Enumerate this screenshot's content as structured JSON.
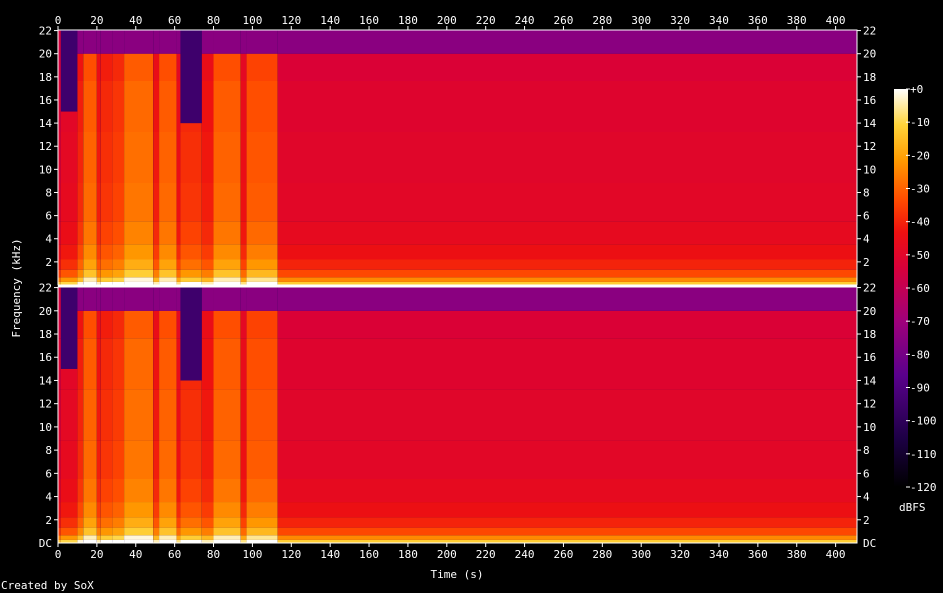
{
  "chart_data": {
    "type": "heatmap",
    "title": "",
    "xlabel": "Time (s)",
    "ylabel": "Frequency (kHz)",
    "xlim": [
      0,
      411
    ],
    "ylim": [
      0,
      22.05
    ],
    "x_ticks": [
      "0",
      "20",
      "40",
      "60",
      "80",
      "100",
      "120",
      "140",
      "160",
      "180",
      "200",
      "220",
      "240",
      "260",
      "280",
      "300",
      "320",
      "340",
      "360",
      "380",
      "400"
    ],
    "y_ticks": [
      "2",
      "4",
      "6",
      "8",
      "10",
      "12",
      "14",
      "16",
      "18",
      "20",
      "22"
    ],
    "y_bottom_label": "DC",
    "channels": 2,
    "colorbar": {
      "label": "dBFS",
      "range": [
        -120,
        0
      ],
      "ticks": [
        "+0",
        "-10",
        "-20",
        "-30",
        "-40",
        "-50",
        "-60",
        "-70",
        "-80",
        "-90",
        "-100",
        "-110",
        "-120"
      ]
    },
    "segments": [
      {
        "start": 0,
        "end": 1.5,
        "level": -52,
        "cutoff_khz": 22
      },
      {
        "start": 1.5,
        "end": 10,
        "level": -48,
        "cutoff_khz": 15
      },
      {
        "start": 10,
        "end": 13,
        "level": -40,
        "cutoff_khz": 20
      },
      {
        "start": 13,
        "end": 20,
        "level": -30,
        "cutoff_khz": 20
      },
      {
        "start": 20,
        "end": 22,
        "level": -42,
        "cutoff_khz": 20
      },
      {
        "start": 22,
        "end": 28,
        "level": -38,
        "cutoff_khz": 20
      },
      {
        "start": 28,
        "end": 34,
        "level": -36,
        "cutoff_khz": 20
      },
      {
        "start": 34,
        "end": 49,
        "level": -28,
        "cutoff_khz": 20
      },
      {
        "start": 49,
        "end": 52,
        "level": -42,
        "cutoff_khz": 20
      },
      {
        "start": 52,
        "end": 61,
        "level": -30,
        "cutoff_khz": 20
      },
      {
        "start": 61,
        "end": 63,
        "level": -45,
        "cutoff_khz": 20
      },
      {
        "start": 63,
        "end": 74,
        "level": -38,
        "cutoff_khz": 14
      },
      {
        "start": 74,
        "end": 80,
        "level": -42,
        "cutoff_khz": 20
      },
      {
        "start": 80,
        "end": 94,
        "level": -30,
        "cutoff_khz": 20
      },
      {
        "start": 94,
        "end": 97,
        "level": -45,
        "cutoff_khz": 20
      },
      {
        "start": 97,
        "end": 113,
        "level": -32,
        "cutoff_khz": 20
      },
      {
        "start": 113,
        "end": 411,
        "level": -50,
        "cutoff_khz": 20
      }
    ],
    "created_by": "Created by SoX"
  }
}
